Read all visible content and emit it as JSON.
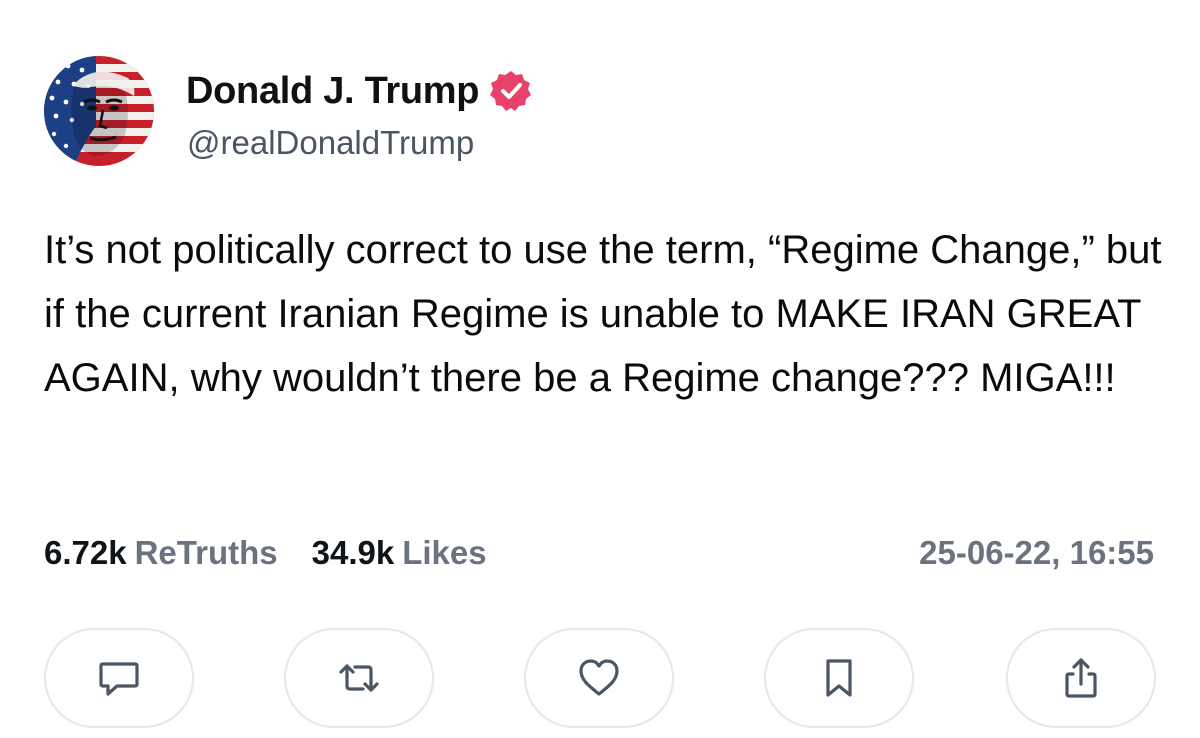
{
  "post": {
    "author": {
      "display_name": "Donald J. Trump",
      "handle": "@realDonaldTrump",
      "verified": true,
      "verified_color": "#e8426b"
    },
    "text": "It’s not politically correct to use the term, “Regime Change,” but if the current Iranian Regime is unable to MAKE IRAN GREAT AGAIN, why wouldn’t there be a Regime change??? MIGA!!!",
    "stats": {
      "retruths_count": "6.72k",
      "retruths_label": "ReTruths",
      "likes_count": "34.9k",
      "likes_label": "Likes"
    },
    "timestamp": "25-06-22, 16:55"
  },
  "actions": [
    {
      "icon": "reply-icon"
    },
    {
      "icon": "retruth-icon"
    },
    {
      "icon": "heart-icon"
    },
    {
      "icon": "bookmark-icon"
    },
    {
      "icon": "share-icon"
    }
  ],
  "colors": {
    "text": "#0f1419",
    "muted": "#6b7280",
    "border": "#e5e7eb",
    "icon": "#4b5563"
  }
}
